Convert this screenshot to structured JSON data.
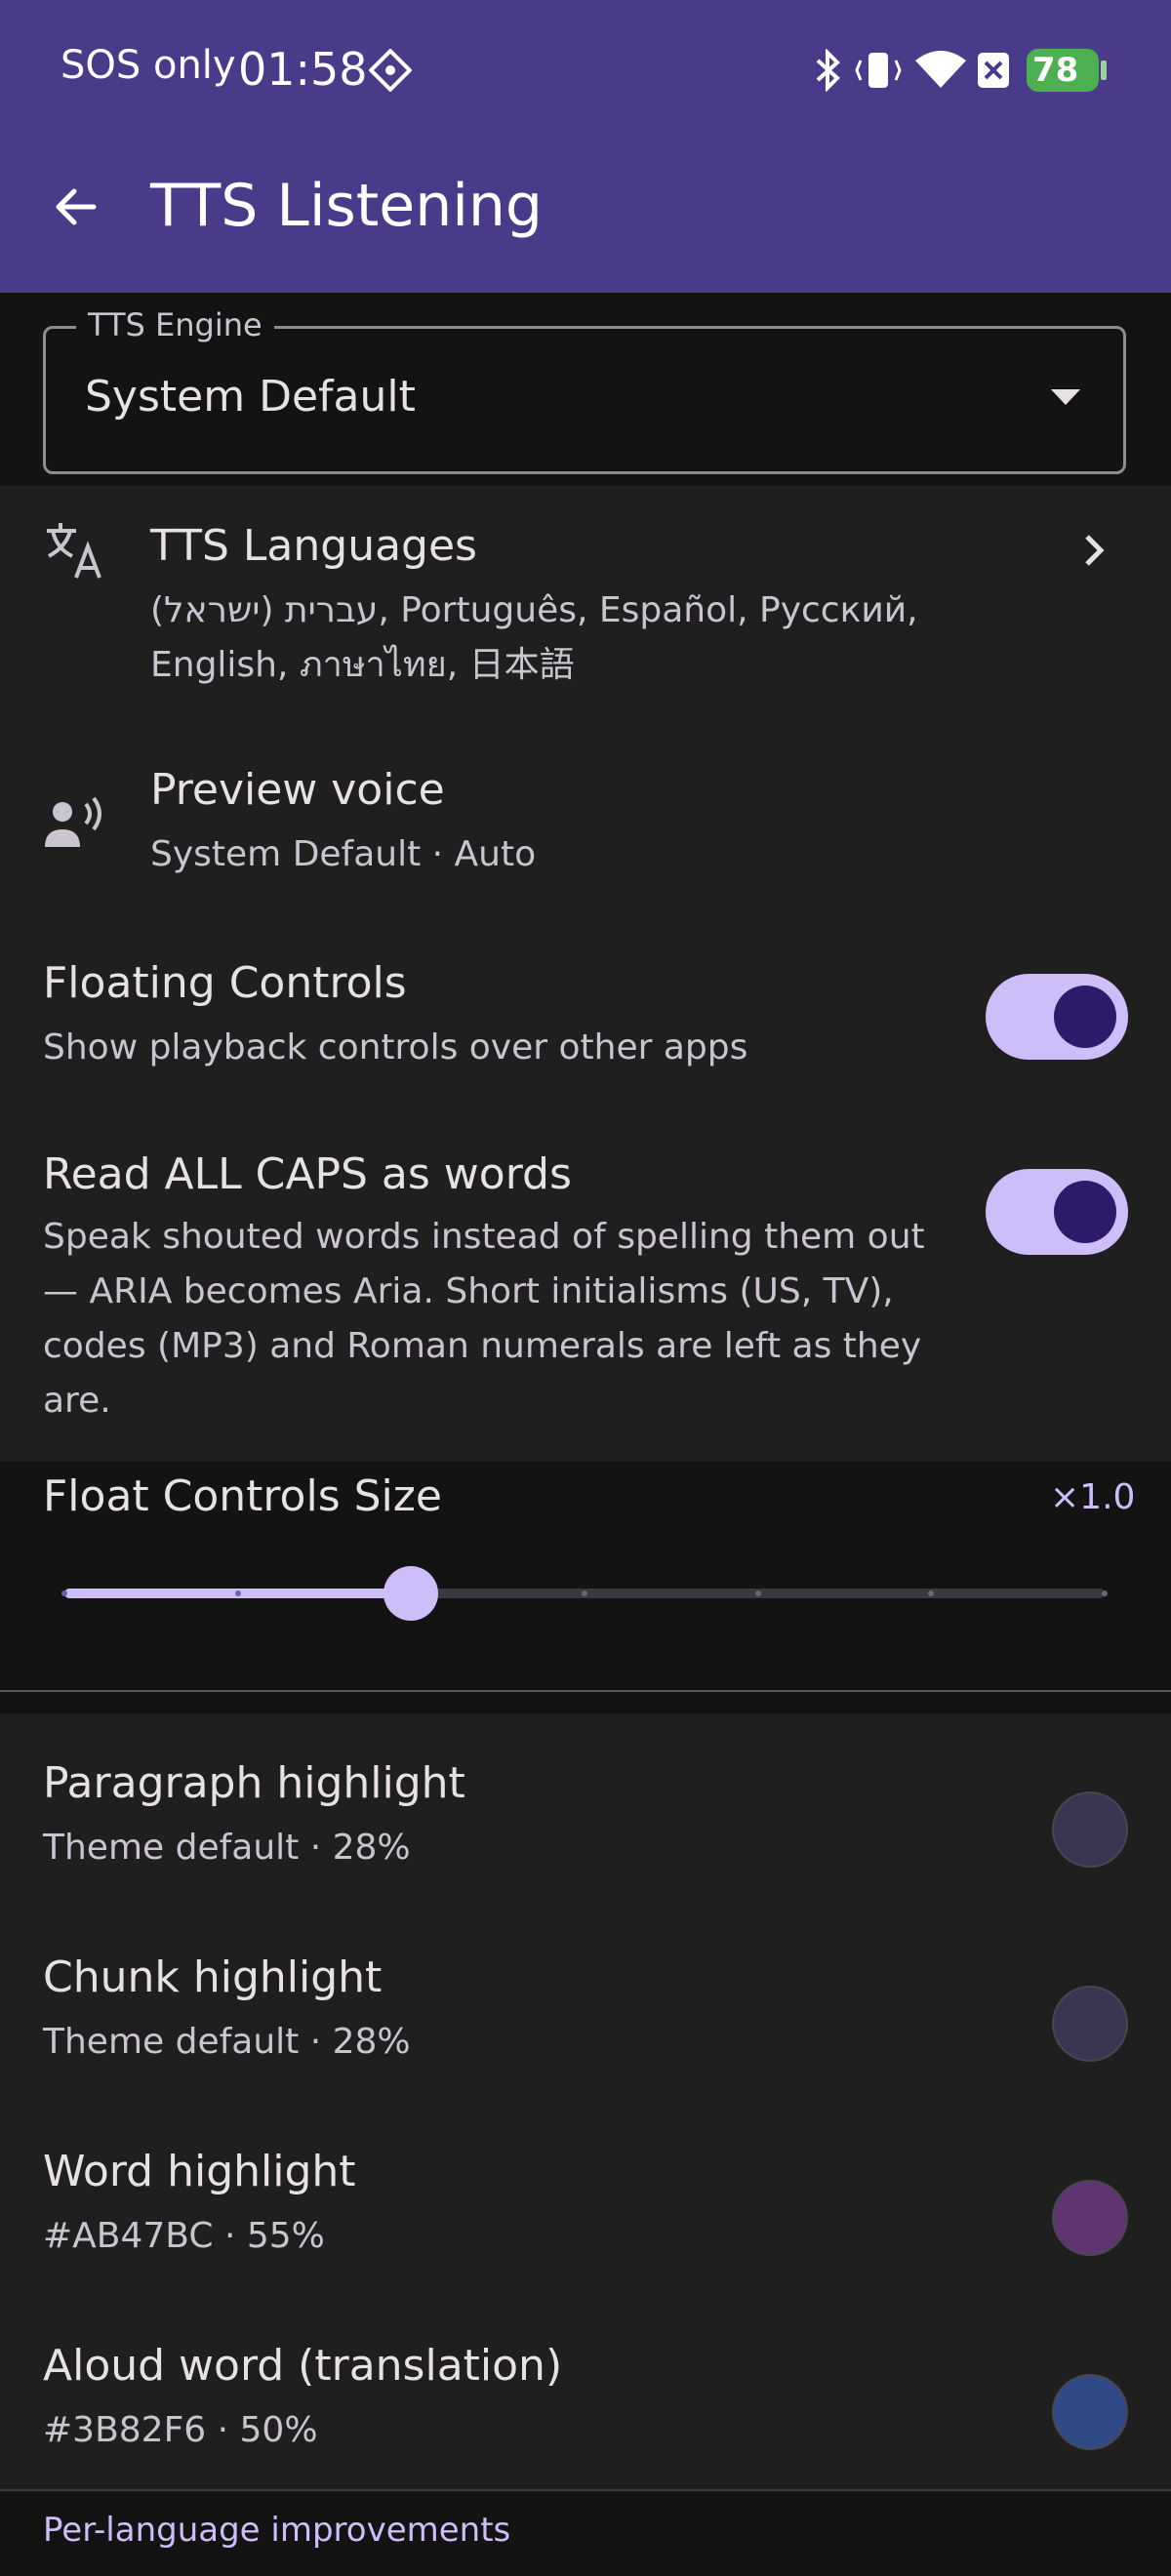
{
  "status_bar": {
    "carrier": "SOS only",
    "time": "01:58",
    "battery": "78"
  },
  "app_bar": {
    "title": "TTS Listening"
  },
  "engine": {
    "label": "TTS Engine",
    "value": "System Default"
  },
  "languages": {
    "title": "TTS Languages",
    "line1": "(עברית (ישראל, Português, Español, Русский,",
    "line2": "English, ภาษาไทย, 日本語"
  },
  "preview": {
    "title": "Preview voice",
    "subtitle": "System Default · Auto"
  },
  "floating": {
    "title": "Floating Controls",
    "subtitle": "Show playback controls over other apps",
    "on": true
  },
  "allcaps": {
    "title": "Read ALL CAPS as words",
    "lines": [
      "Speak shouted words instead of spelling them out",
      "— ARIA becomes Aria. Short initialisms (US, TV),",
      "codes (MP3) and Roman numerals are left as they",
      "are."
    ],
    "on": true
  },
  "float_size": {
    "title": "Float Controls Size",
    "value_label": "×1.0",
    "slider_fraction": 0.333,
    "ticks": 7
  },
  "highlights": [
    {
      "title": "Paragraph highlight",
      "subtitle": "Theme default · 28%",
      "color": "#3b3552"
    },
    {
      "title": "Chunk highlight",
      "subtitle": "Theme default · 28%",
      "color": "#3b3552"
    },
    {
      "title": "Word highlight",
      "subtitle": "#AB47BC · 55%",
      "color": "#5e3570"
    },
    {
      "title": "Aloud word (translation)",
      "subtitle": "#3B82F6 · 50%",
      "color": "#2f4a86"
    }
  ],
  "per_language": {
    "label": "Per-language improvements"
  },
  "colors": {
    "app_bar": "#4a3a8a",
    "accent": "#cdbdf8",
    "battery": "#4caf50"
  }
}
